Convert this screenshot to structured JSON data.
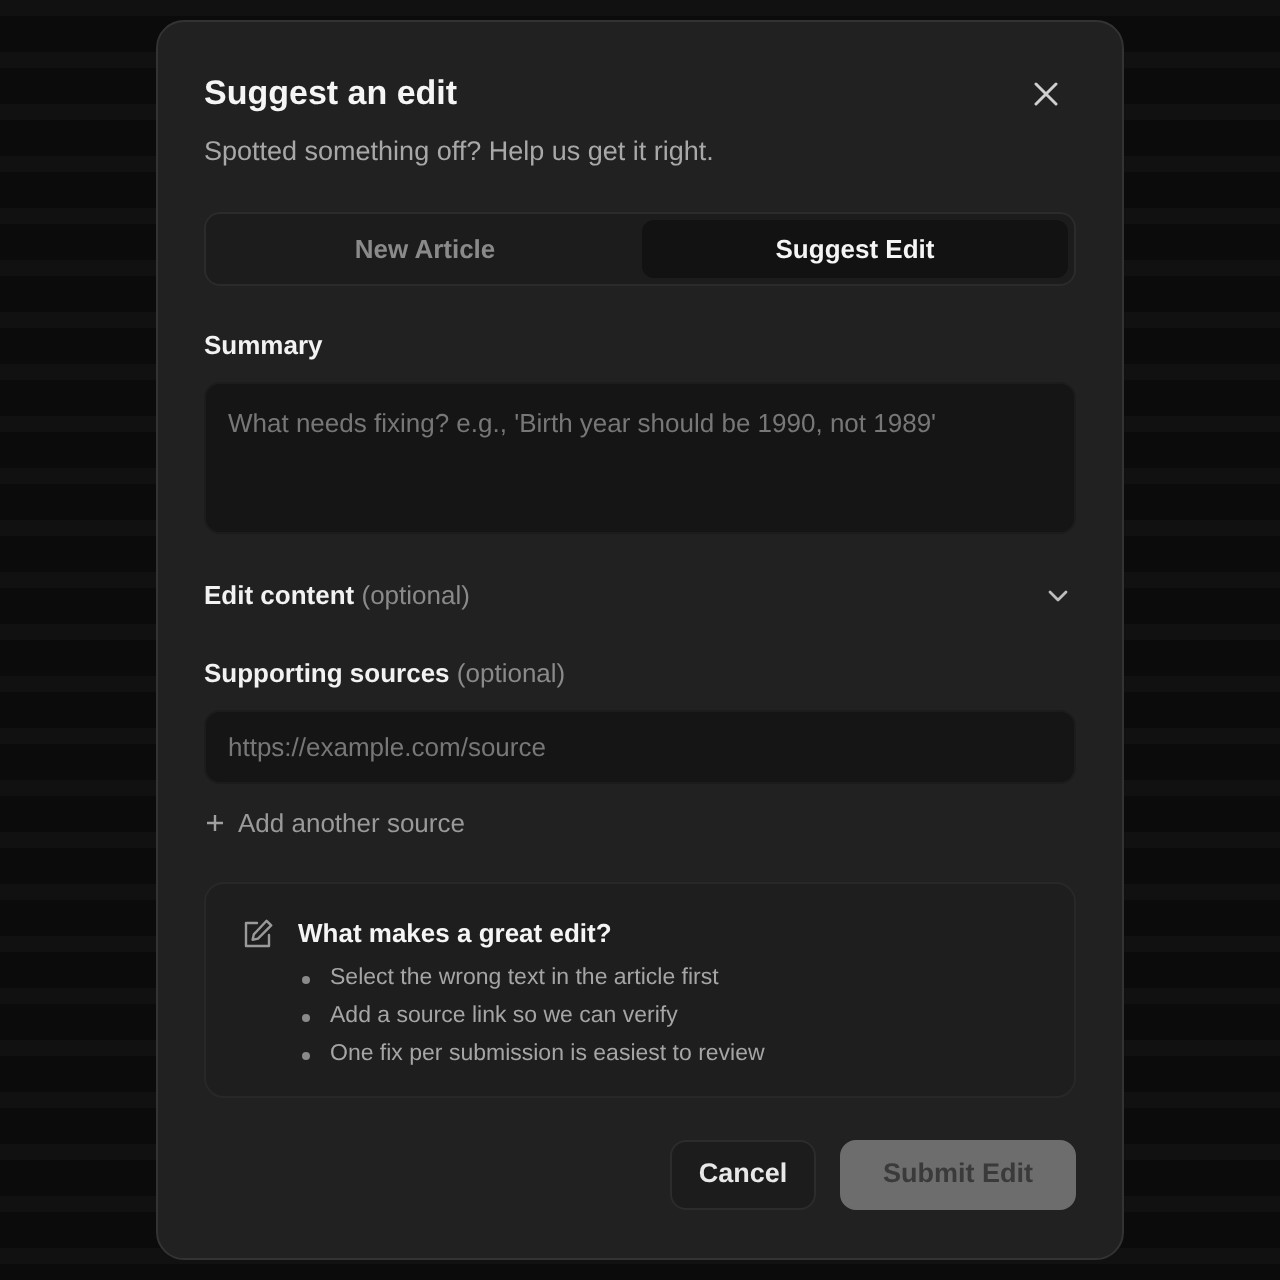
{
  "dialog": {
    "title": "Suggest an edit",
    "subtitle": "Spotted something off? Help us get it right."
  },
  "tabs": [
    {
      "label": "New Article",
      "selected": false
    },
    {
      "label": "Suggest Edit",
      "selected": true
    }
  ],
  "summary": {
    "label": "Summary",
    "placeholder": "What needs fixing? e.g., 'Birth year should be 1990, not 1989'"
  },
  "edit_content": {
    "label": "Edit content",
    "hint": "(optional)",
    "expanded": false
  },
  "sources": {
    "label": "Supporting sources",
    "hint": "(optional)",
    "placeholder": "https://example.com/source",
    "add_label": "Add another source"
  },
  "tips": {
    "title": "What makes a great edit?",
    "items": [
      "Select the wrong text in the article first",
      "Add a source link so we can verify",
      "One fix per submission is easiest to review"
    ]
  },
  "buttons": [
    {
      "label": "Cancel",
      "kind": "secondary",
      "disabled": false
    },
    {
      "label": "Submit Edit",
      "kind": "primary",
      "disabled": true
    }
  ]
}
